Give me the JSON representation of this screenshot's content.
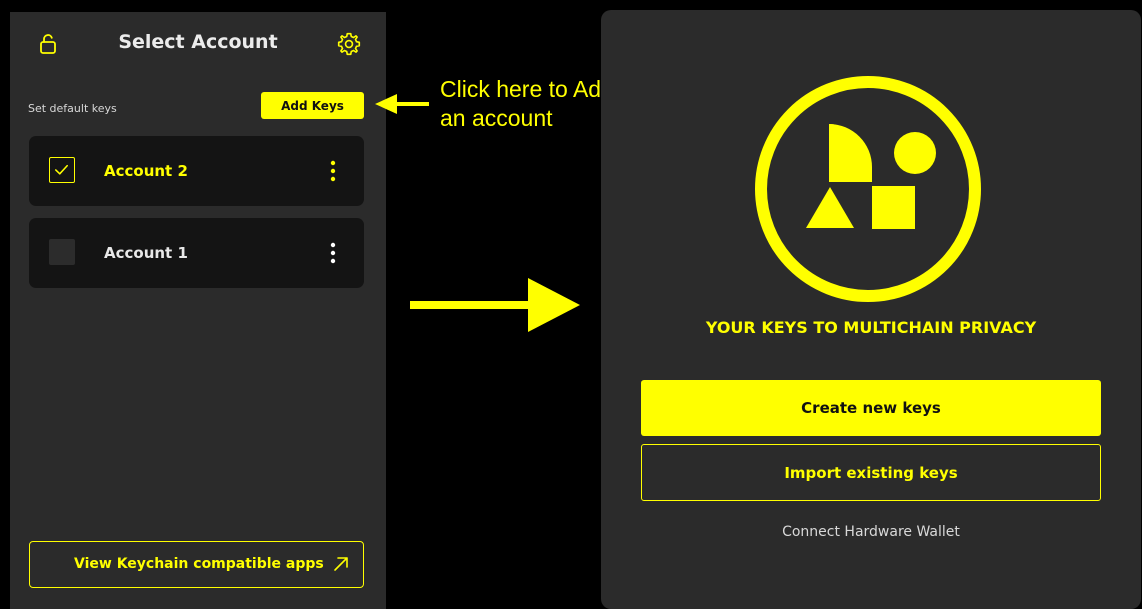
{
  "colors": {
    "accent": "#ffff00",
    "panel_bg": "#2b2b2b",
    "card_bg": "#141414",
    "page_bg": "#000000"
  },
  "select_account": {
    "header": {
      "title": "Select Account",
      "left_icon": "unlock-icon",
      "right_icon": "gear-icon"
    },
    "default_keys_label": "Set default keys",
    "add_keys_button": "Add Keys",
    "accounts": [
      {
        "name": "Account 2",
        "checked": true,
        "menu_icon": "more-vertical-icon"
      },
      {
        "name": "Account 1",
        "checked": false,
        "menu_icon": "more-vertical-icon"
      }
    ],
    "footer_button": {
      "label": "View Keychain compatible apps",
      "icon": "external-link-icon"
    }
  },
  "annotation": {
    "text_line_1": "Click here to Add/Import",
    "text_line_2": "an account"
  },
  "onboarding": {
    "logo_icon": "keychain-logo-icon",
    "tagline": "YOUR KEYS TO MULTICHAIN PRIVACY",
    "create_button": "Create new keys",
    "import_button": "Import existing keys",
    "hardware_link": "Connect Hardware Wallet"
  }
}
